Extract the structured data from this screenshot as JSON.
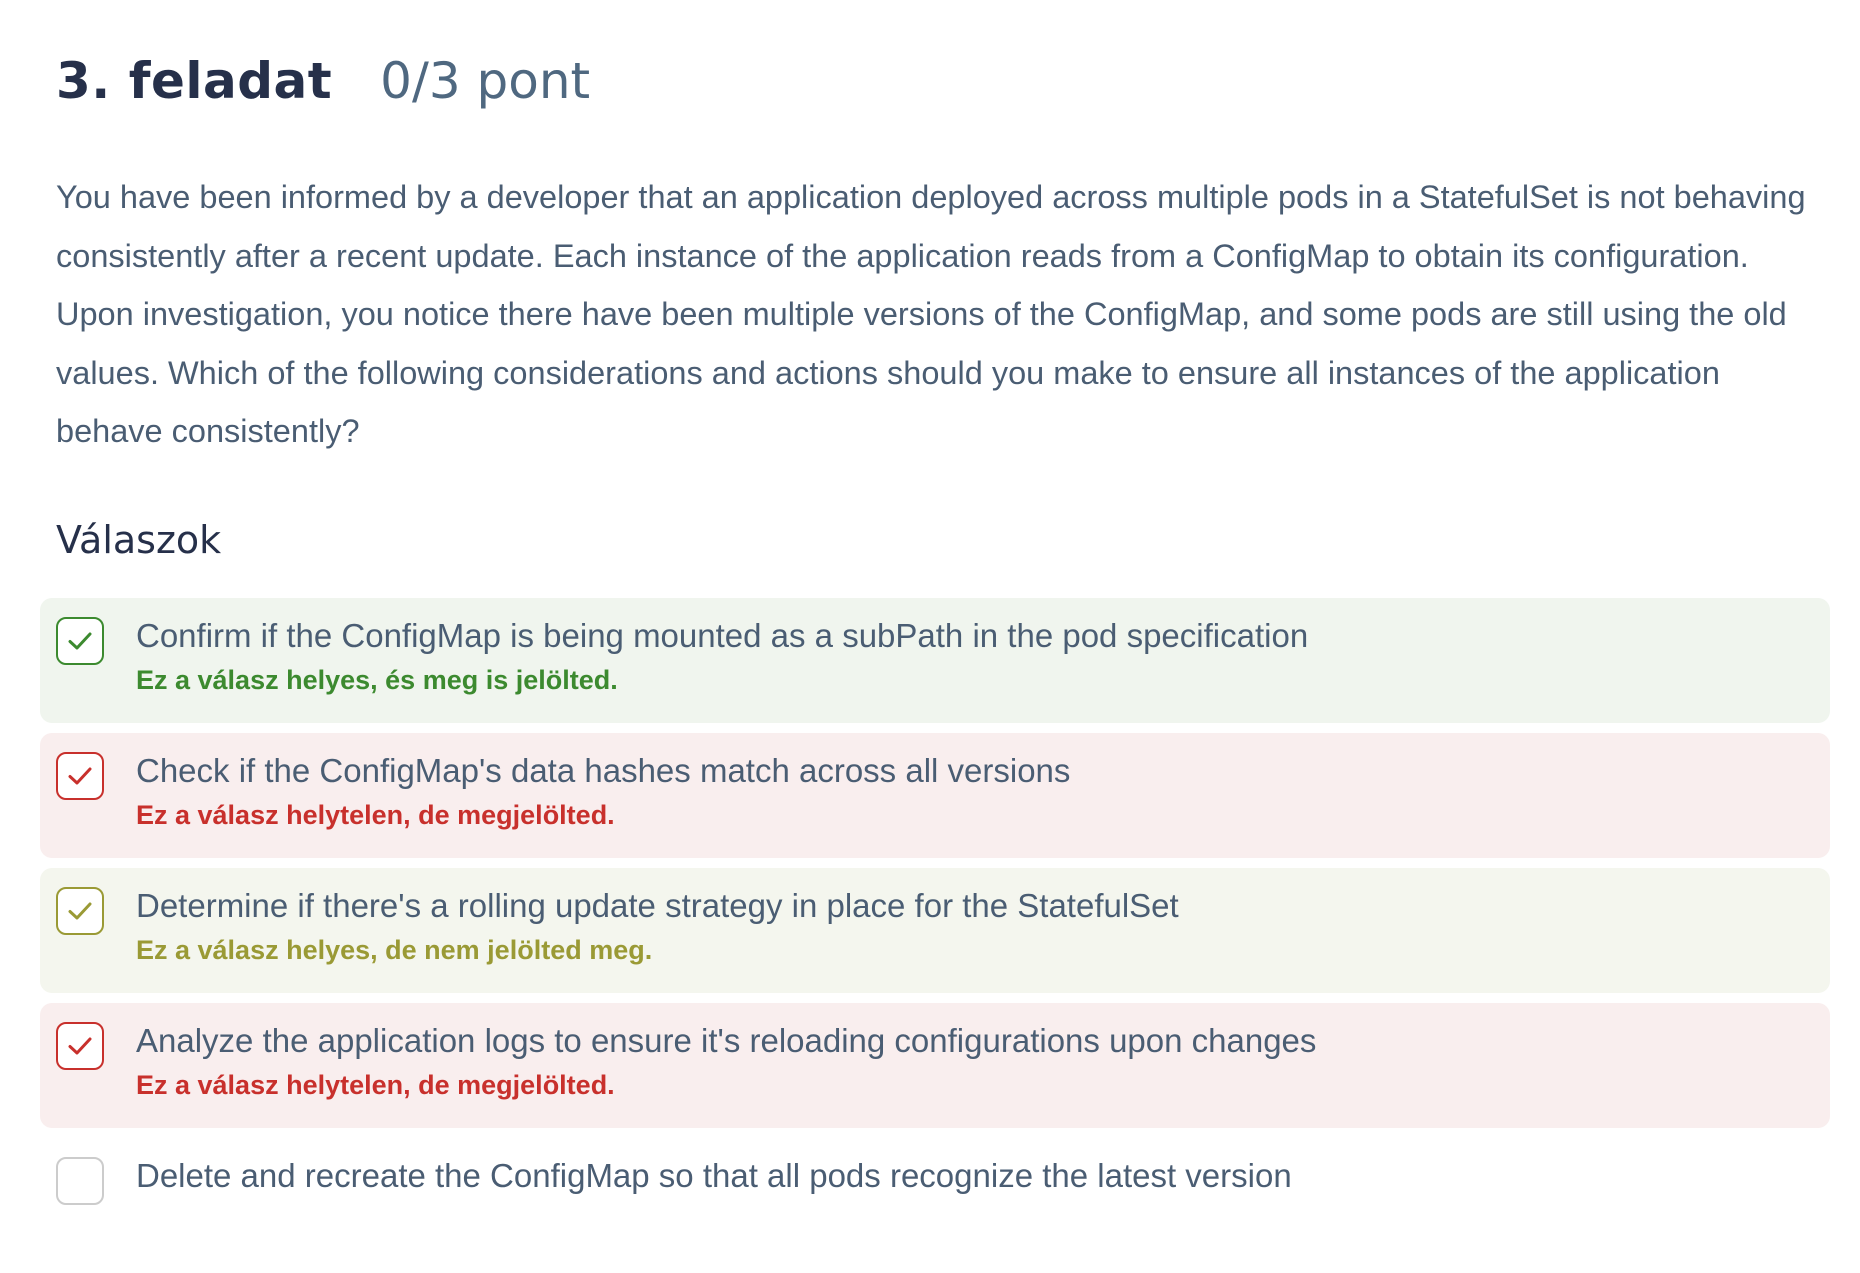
{
  "task": {
    "title": "3. feladat",
    "points": "0/3 pont"
  },
  "question": "You have been informed by a developer that an application deployed across multiple pods in a StatefulSet is not behaving consistently after a recent update. Each instance of the application reads from a ConfigMap to obtain its configuration. Upon investigation, you notice there have been multiple versions of the ConfigMap, and some pods are still using the old values. Which of the following considerations and actions should you make to ensure all instances of the application behave consistently?",
  "answers_title": "Válaszok",
  "colors": {
    "correct": "#3c8a2f",
    "wrong": "#c8302c",
    "missed": "#9a9a35"
  },
  "answers": [
    {
      "text": "Confirm if the ConfigMap is being mounted as a subPath in the pod specification",
      "feedback": "Ez a válasz helyes, és meg is jelölted.",
      "checked": true,
      "status": "correct-marked",
      "icon": "check-icon"
    },
    {
      "text": "Check if the ConfigMap's data hashes match across all versions",
      "feedback": "Ez a válasz helytelen, de megjelölted.",
      "checked": true,
      "status": "wrong-marked",
      "icon": "check-icon"
    },
    {
      "text": "Determine if there's a rolling update strategy in place for the StatefulSet",
      "feedback": "Ez a válasz helyes, de nem jelölted meg.",
      "checked": false,
      "status": "correct-missed",
      "icon": "check-icon"
    },
    {
      "text": "Analyze the application logs to ensure it's reloading configurations upon changes",
      "feedback": "Ez a válasz helytelen, de megjelölted.",
      "checked": true,
      "status": "wrong-marked",
      "icon": "check-icon"
    },
    {
      "text": "Delete and recreate the ConfigMap so that all pods recognize the latest version",
      "feedback": "",
      "checked": false,
      "status": "neutral",
      "icon": ""
    }
  ]
}
